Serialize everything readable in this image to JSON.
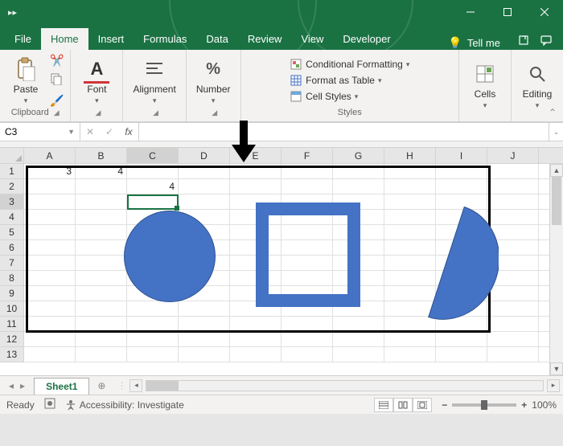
{
  "window": {
    "quick_access": "▸▸"
  },
  "tabs": {
    "file": "File",
    "home": "Home",
    "insert": "Insert",
    "formulas": "Formulas",
    "data": "Data",
    "review": "Review",
    "view": "View",
    "developer": "Developer",
    "tellme": "Tell me"
  },
  "ribbon": {
    "clipboard": {
      "label": "Clipboard",
      "paste": "Paste"
    },
    "font": {
      "label": "Font",
      "btn": "Font"
    },
    "alignment": {
      "label": "Alignment",
      "btn": "Alignment"
    },
    "number": {
      "label": "Number",
      "btn": "Number"
    },
    "styles": {
      "label": "Styles",
      "cond": "Conditional Formatting",
      "table": "Format as Table",
      "cell": "Cell Styles"
    },
    "cells": {
      "label": "Cells",
      "btn": "Cells"
    },
    "editing": {
      "label": "Editing",
      "btn": "Editing"
    }
  },
  "fx": {
    "namebox": "C3",
    "formula": ""
  },
  "grid": {
    "cols": [
      "A",
      "B",
      "C",
      "D",
      "E",
      "F",
      "G",
      "H",
      "I",
      "J"
    ],
    "rows": [
      "1",
      "2",
      "3",
      "4",
      "5",
      "6",
      "7",
      "8",
      "9",
      "10",
      "11",
      "12",
      "13"
    ],
    "a1": "3",
    "b1": "4",
    "c2": "4",
    "active_col": "C",
    "active_row": "3"
  },
  "sheet": {
    "name": "Sheet1"
  },
  "status": {
    "ready": "Ready",
    "access": "Accessibility: Investigate",
    "zoom": "100%"
  },
  "chart_data": null
}
